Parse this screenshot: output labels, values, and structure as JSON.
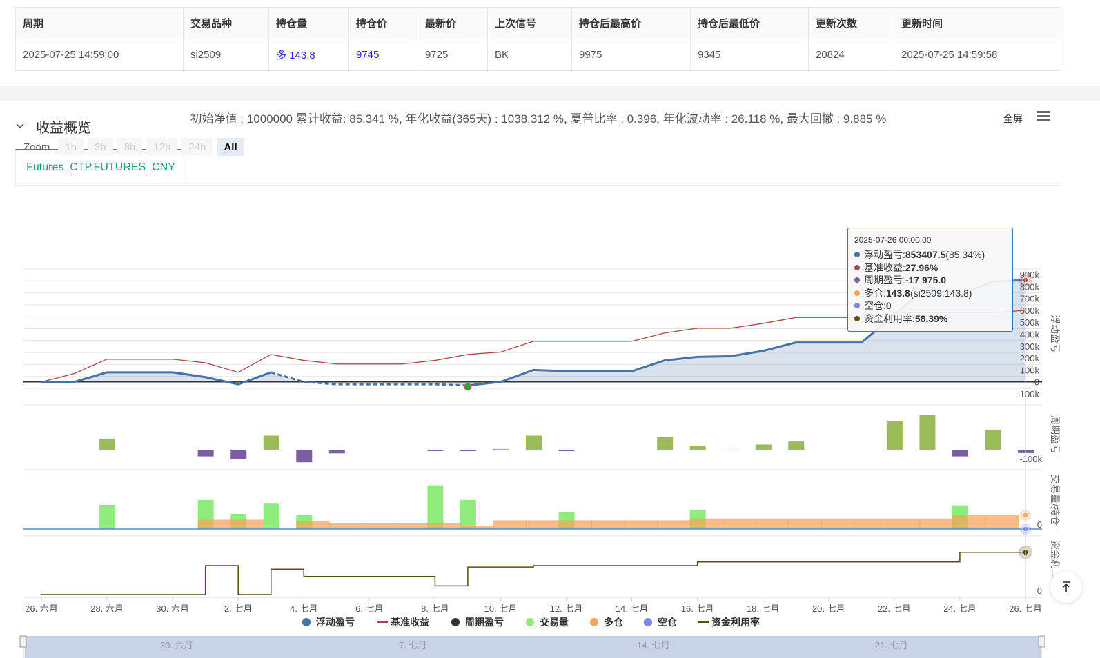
{
  "positions_table": {
    "headers": [
      "周期",
      "交易品种",
      "持仓量",
      "持仓价",
      "最新价",
      "上次信号",
      "持仓后最高价",
      "持仓后最低价",
      "更新次数",
      "更新时间"
    ],
    "row": [
      "2025-07-25 14:59:00",
      "si2509",
      "多 143.8",
      "9745",
      "9725",
      "BK",
      "9975",
      "9345",
      "20824",
      "2025-07-25 14:59:58"
    ]
  },
  "section": {
    "title": "收益概览",
    "tab": "Futures_CTP.FUTURES_CNY"
  },
  "stats": "初始净值 : 1000000 累计收益: 85.341 %, 年化收益(365天) : 1038.312 %, 夏普比率 : 0.396, 年化波动率 : 26.118 %, 最大回撤 : 9.885 %",
  "toolbar": {
    "fullscreen": "全屏"
  },
  "zoom": {
    "label": "Zoom",
    "buttons": [
      "1h",
      "3h",
      "8h",
      "12h",
      "24h",
      "All"
    ],
    "active": "All"
  },
  "tooltip": {
    "title": "2025-07-26 00:00:00",
    "rows": [
      {
        "label": "浮动盈亏: ",
        "value": "853407.5",
        "extra": " (85.34%)",
        "color": "#4572a7"
      },
      {
        "label": "基准收益: ",
        "value": "27.96%",
        "extra": "",
        "color": "#aa4643"
      },
      {
        "label": "周期盈亏: ",
        "value": "-17 975.0",
        "extra": "",
        "color": "#7b5e9e"
      },
      {
        "label": "多仓: ",
        "value": "143.8",
        "extra": " (si2509:143.8)",
        "color": "#f7a35c"
      },
      {
        "label": "空仓: ",
        "value": "0",
        "extra": "",
        "color": "#8085e9"
      },
      {
        "label": "资金利用率: ",
        "value": "58.39%",
        "extra": "",
        "color": "#5c4a10"
      }
    ]
  },
  "legend": [
    {
      "name": "浮动盈亏",
      "color": "#4572a7",
      "kind": "dot"
    },
    {
      "name": "基准收益",
      "color": "#aa4643",
      "kind": "line"
    },
    {
      "name": "周期盈亏",
      "color": "#333333",
      "kind": "dot"
    },
    {
      "name": "交易量",
      "color": "#90ed7d",
      "kind": "dot"
    },
    {
      "name": "多仓",
      "color": "#f7a35c",
      "kind": "dot"
    },
    {
      "name": "空仓",
      "color": "#8085e9",
      "kind": "dot"
    },
    {
      "name": "资金利用率",
      "color": "#5c4a10",
      "kind": "line"
    }
  ],
  "axis_titles": {
    "pnl": "浮动盈亏",
    "period": "周期盈亏",
    "volume": "交易量/持仓",
    "capital": "资金利..."
  },
  "navigator_labels": [
    "30. 六月",
    "7. 七月",
    "14. 七月",
    "21. 七月"
  ],
  "chart_data": {
    "type": "line",
    "x": [
      "2025-06-26",
      "2025-06-27",
      "2025-06-28",
      "2025-06-29",
      "2025-06-30",
      "2025-07-01",
      "2025-07-02",
      "2025-07-03",
      "2025-07-04",
      "2025-07-05",
      "2025-07-06",
      "2025-07-07",
      "2025-07-08",
      "2025-07-09",
      "2025-07-10",
      "2025-07-11",
      "2025-07-12",
      "2025-07-13",
      "2025-07-14",
      "2025-07-15",
      "2025-07-16",
      "2025-07-17",
      "2025-07-18",
      "2025-07-19",
      "2025-07-20",
      "2025-07-21",
      "2025-07-22",
      "2025-07-23",
      "2025-07-24",
      "2025-07-25",
      "2025-07-26"
    ],
    "x_tick_labels": [
      "26. 六月",
      "28. 六月",
      "30. 六月",
      "2. 七月",
      "4. 七月",
      "6. 七月",
      "8. 七月",
      "10. 七月",
      "12. 七月",
      "14. 七月",
      "16. 七月",
      "18. 七月",
      "20. 七月",
      "22. 七月",
      "24. 七月",
      "26. 七月"
    ],
    "pnl_axis": {
      "ticks": [
        "900k",
        "800k",
        "700k",
        "600k",
        "500k",
        "400k",
        "300k",
        "200k",
        "100k",
        "0",
        "-100k"
      ],
      "ylim": [
        -100000,
        900000
      ]
    },
    "series": [
      {
        "name": "浮动盈亏",
        "values": [
          0,
          0,
          80000,
          80000,
          80000,
          40000,
          -20000,
          80000,
          0,
          -20000,
          -20000,
          -20000,
          -20000,
          -30000,
          0,
          100000,
          90000,
          90000,
          90000,
          180000,
          210000,
          215000,
          260000,
          330000,
          330000,
          330000,
          560000,
          800000,
          730000,
          840000,
          853407.5
        ]
      },
      {
        "name": "基准收益",
        "values": [
          0,
          70000,
          190000,
          190000,
          190000,
          160000,
          80000,
          230000,
          180000,
          150000,
          150000,
          150000,
          180000,
          230000,
          250000,
          340000,
          340000,
          340000,
          340000,
          410000,
          450000,
          450000,
          490000,
          540000,
          540000,
          540000,
          580000,
          580000,
          580000,
          580000,
          600000
        ]
      },
      {
        "name": "周期盈亏",
        "values": [
          0,
          0,
          80000,
          0,
          0,
          -40000,
          -60000,
          100000,
          -80000,
          -20000,
          0,
          0,
          -2000,
          -5000,
          10000,
          100000,
          -2000,
          0,
          0,
          90000,
          30000,
          2000,
          40000,
          60000,
          0,
          0,
          200000,
          240000,
          -40000,
          140000,
          -17975
        ]
      },
      {
        "name": "交易量",
        "values": [
          0,
          0,
          40,
          0,
          0,
          48,
          25,
          43,
          23,
          0,
          0,
          0,
          72,
          48,
          0,
          0,
          28,
          0,
          0,
          0,
          31,
          0,
          0,
          0,
          0,
          0,
          0,
          0,
          39,
          0,
          0
        ]
      },
      {
        "name": "多仓",
        "values": [
          0,
          0,
          0,
          0,
          0,
          15,
          15,
          0,
          13,
          10,
          10,
          10,
          10,
          5,
          14,
          14,
          14,
          14,
          14,
          14,
          17,
          17,
          17,
          17,
          17,
          17,
          17,
          17,
          23,
          23,
          23
        ]
      },
      {
        "name": "空仓",
        "values": [
          0,
          0,
          0,
          0,
          0,
          0,
          0,
          0,
          0,
          0,
          0,
          0,
          0,
          0,
          0,
          0,
          0,
          0,
          0,
          0,
          0,
          0,
          0,
          0,
          0,
          0,
          0,
          0,
          0,
          0,
          0
        ]
      },
      {
        "name": "资金利用率",
        "values": [
          0,
          0,
          0,
          0,
          0,
          40,
          0,
          35,
          25,
          25,
          25,
          25,
          12,
          38,
          38,
          40,
          40,
          40,
          40,
          40,
          45,
          45,
          45,
          45,
          45,
          45,
          45,
          45,
          58.39,
          58.39,
          58.39
        ]
      }
    ],
    "period_axis": {
      "ticks": [
        "-100k"
      ]
    },
    "volume_axis": {
      "ticks": [
        "0"
      ]
    },
    "capital_axis": {
      "ticks": [
        "0"
      ]
    }
  }
}
